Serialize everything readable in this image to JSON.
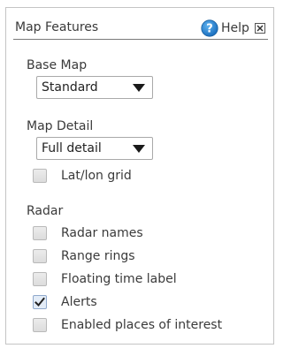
{
  "panel": {
    "title": "Map Features",
    "help_label": "Help"
  },
  "base_map": {
    "label": "Base Map",
    "selected": "Standard"
  },
  "map_detail": {
    "label": "Map Detail",
    "selected": "Full detail"
  },
  "latlon_grid": {
    "label": "Lat/lon grid",
    "checked": false
  },
  "radar": {
    "label": "Radar",
    "options": [
      {
        "label": "Radar names",
        "checked": false
      },
      {
        "label": "Range rings",
        "checked": false
      },
      {
        "label": "Floating time label",
        "checked": false
      },
      {
        "label": "Alerts",
        "checked": true
      },
      {
        "label": "Enabled places of interest",
        "checked": false
      }
    ]
  },
  "colors": {
    "help_icon": "#1f7fd0",
    "border": "#c4c4c4",
    "header_rule": "#7a7a7a",
    "text": "#3a3a3a"
  },
  "icons": {
    "help": "question-circle-icon",
    "close": "close-x-icon",
    "dropdown": "chevron-down-icon",
    "checked": "checkmark-icon"
  }
}
